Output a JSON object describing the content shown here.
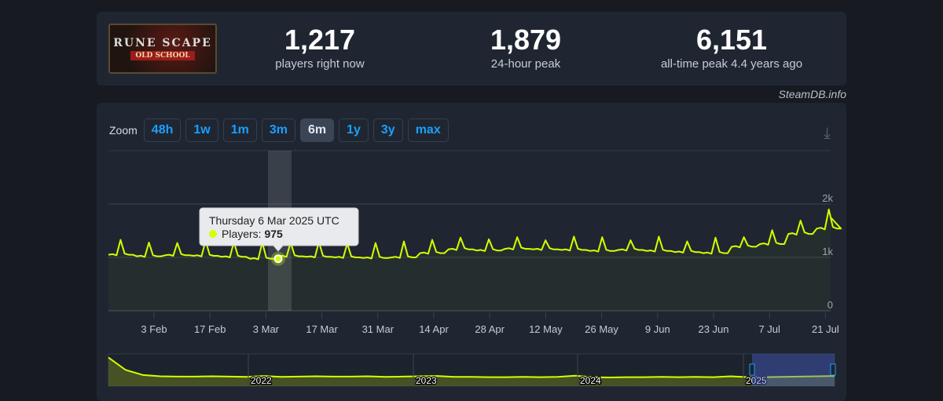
{
  "header": {
    "logo_text": "RuneScape Old School",
    "players_now": "1,217",
    "players_now_label": "players right now",
    "peak_24h": "1,879",
    "peak_24h_label": "24-hour peak",
    "all_time_peak": "6,151",
    "all_time_peak_label": "all-time peak 4.4 years ago"
  },
  "credit": "SteamDB.info",
  "zoom": {
    "label": "Zoom",
    "buttons": [
      "48h",
      "1w",
      "1m",
      "3m",
      "6m",
      "1y",
      "3y",
      "max"
    ],
    "active": "6m"
  },
  "tooltip": {
    "title": "Thursday 6 Mar 2025 UTC",
    "series": "Players: ",
    "value": "975"
  },
  "colors": {
    "line": "#d4ff00",
    "accent": "#1a9fff"
  },
  "chart_data": {
    "type": "line",
    "series_name": "Players",
    "x_start": "23 Jan 2025",
    "x_end": "22 Jul 2025",
    "weekly_trough_peak": [
      [
        1050,
        1330
      ],
      [
        1020,
        1280
      ],
      [
        1040,
        1270
      ],
      [
        1030,
        1310
      ],
      [
        1010,
        1290
      ],
      [
        975,
        1280
      ],
      [
        1020,
        1280
      ],
      [
        1010,
        1290
      ],
      [
        1000,
        1260
      ],
      [
        990,
        1270
      ],
      [
        1000,
        1300
      ],
      [
        1080,
        1330
      ],
      [
        1150,
        1370
      ],
      [
        1130,
        1340
      ],
      [
        1160,
        1380
      ],
      [
        1150,
        1320
      ],
      [
        1140,
        1390
      ],
      [
        1120,
        1380
      ],
      [
        1140,
        1320
      ],
      [
        1120,
        1390
      ],
      [
        1100,
        1300
      ],
      [
        1080,
        1370
      ],
      [
        1200,
        1380
      ],
      [
        1250,
        1510
      ],
      [
        1440,
        1690
      ],
      [
        1540,
        1900
      ]
    ],
    "end_value": 1750,
    "ylim": [
      0,
      2000
    ],
    "y_ticks": [
      "0",
      "1k",
      "2k"
    ],
    "x_ticks": [
      "3 Feb",
      "17 Feb",
      "3 Mar",
      "17 Mar",
      "31 Mar",
      "14 Apr",
      "28 Apr",
      "12 May",
      "26 May",
      "9 Jun",
      "23 Jun",
      "7 Jul",
      "21 Jul"
    ],
    "navigator": {
      "years": [
        "2022",
        "2023",
        "2024",
        "2025"
      ],
      "values": [
        4200,
        2200,
        1400,
        1200,
        1150,
        1150,
        1200,
        1150,
        1100,
        1250,
        1100,
        1150,
        1200,
        1150,
        1150,
        1200,
        1100,
        1150,
        1200,
        1250,
        1100,
        1100,
        1050,
        1050,
        1100,
        1050,
        1100,
        1300,
        1050,
        1000,
        1050,
        1050,
        1100,
        1050,
        1100,
        1050,
        1200,
        1050,
        1050,
        1100,
        1150,
        1200,
        1250
      ]
    }
  }
}
